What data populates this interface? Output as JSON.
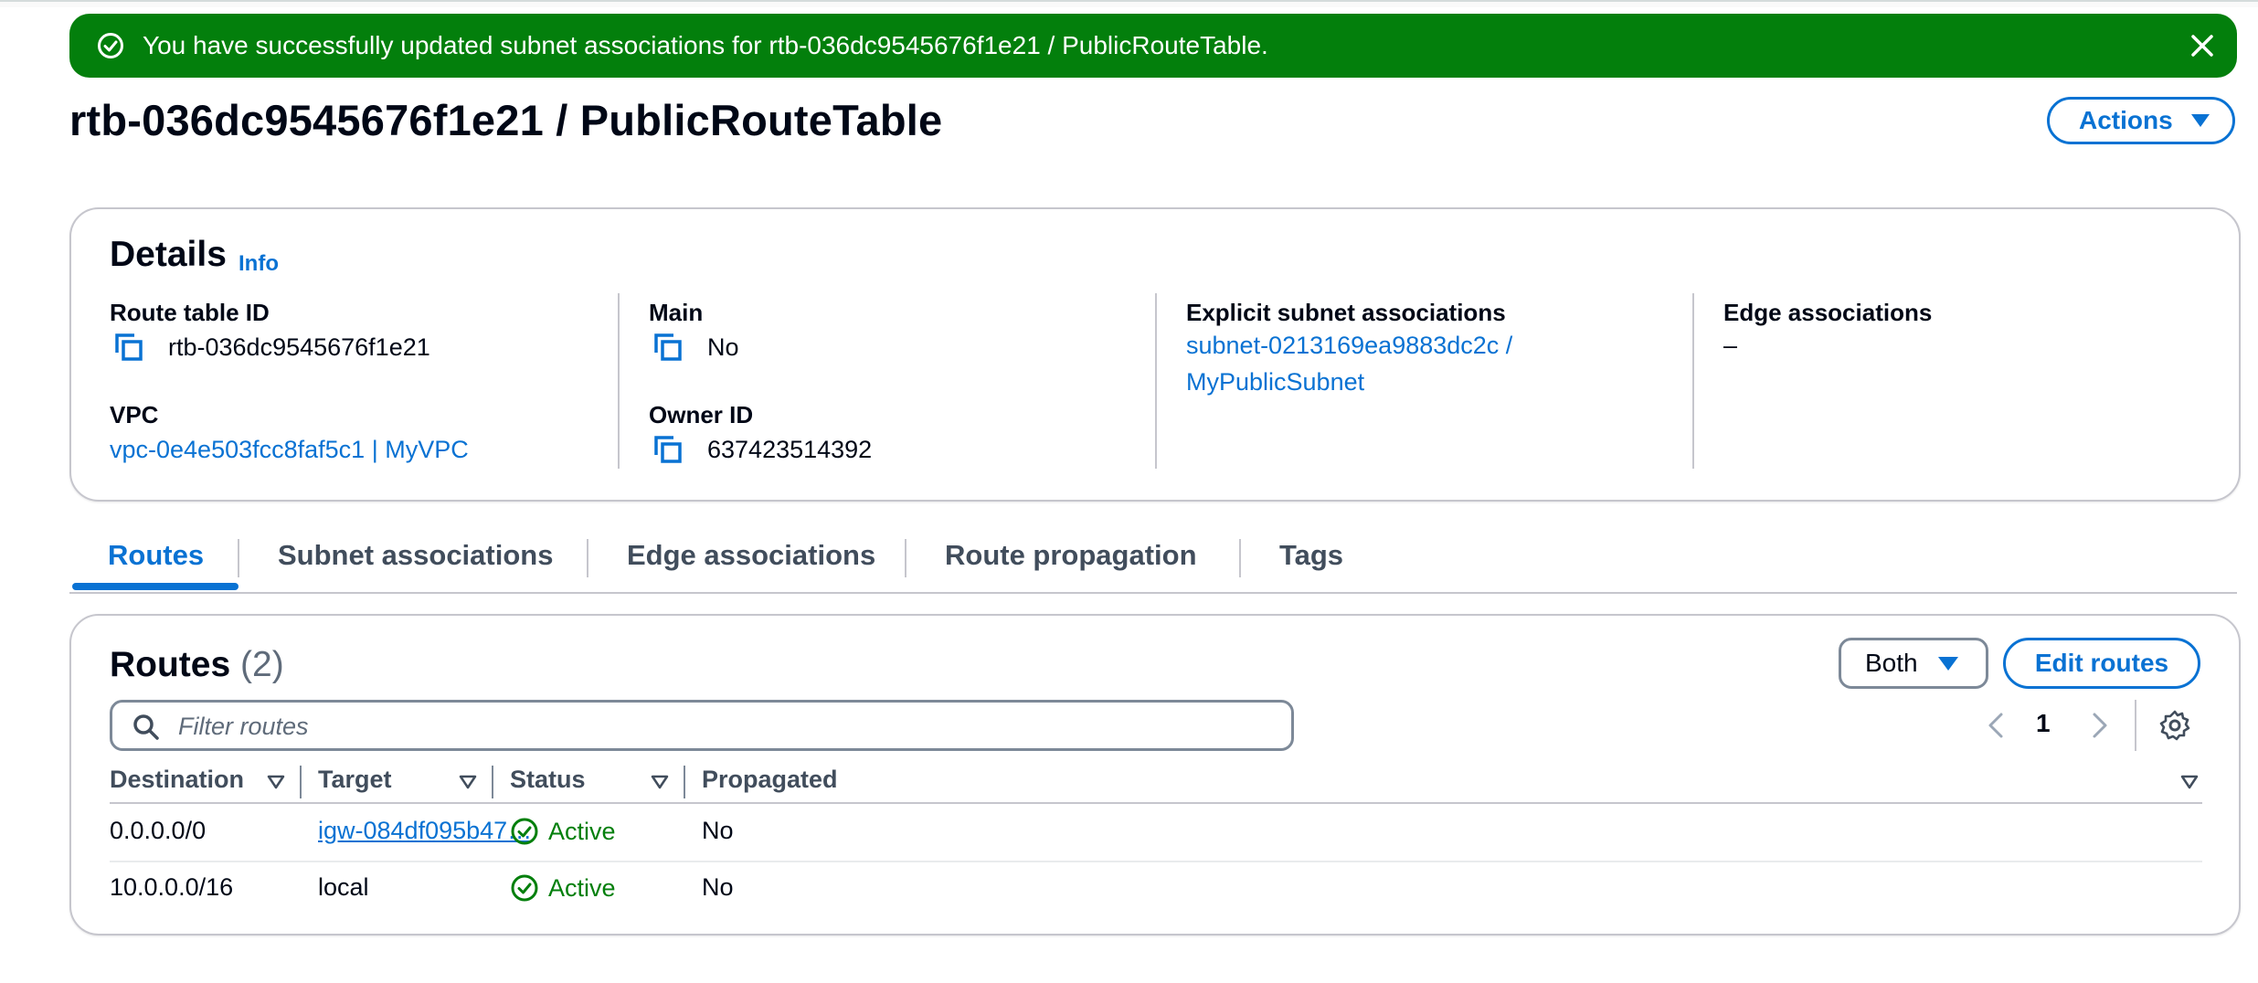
{
  "flash": {
    "message": "You have successfully updated subnet associations for rtb-036dc9545676f1e21 / PublicRouteTable.",
    "icon": "check-circle-icon",
    "close_icon": "close-icon",
    "color": "#037f0c"
  },
  "header": {
    "title": "rtb-036dc9545676f1e21 / PublicRouteTable",
    "actions_label": "Actions"
  },
  "details": {
    "title": "Details",
    "info_label": "Info",
    "route_table_id_label": "Route table ID",
    "route_table_id_value": "rtb-036dc9545676f1e21",
    "vpc_label": "VPC",
    "vpc_value": "vpc-0e4e503fcc8faf5c1 | MyVPC",
    "main_label": "Main",
    "main_value": "No",
    "owner_id_label": "Owner ID",
    "owner_id_value": "637423514392",
    "explicit_label": "Explicit subnet associations",
    "explicit_value_line1": "subnet-0213169ea9883dc2c /",
    "explicit_value_line2": "MyPublicSubnet",
    "edge_label": "Edge associations",
    "edge_value": "–"
  },
  "tabs": [
    {
      "label": "Routes",
      "active": true
    },
    {
      "label": "Subnet associations",
      "active": false
    },
    {
      "label": "Edge associations",
      "active": false
    },
    {
      "label": "Route propagation",
      "active": false
    },
    {
      "label": "Tags",
      "active": false
    }
  ],
  "routes": {
    "title": "Routes",
    "count": "(2)",
    "filter_select": "Both",
    "edit_label": "Edit routes",
    "filter_placeholder": "Filter routes",
    "page": "1",
    "columns": [
      "Destination",
      "Target",
      "Status",
      "Propagated"
    ],
    "rows": [
      {
        "destination": "0.0.0.0/0",
        "target": "igw-084df095b47…",
        "status": "Active",
        "propagated": "No"
      },
      {
        "destination": "10.0.0.0/16",
        "target": "local",
        "status": "Active",
        "propagated": "No"
      }
    ]
  },
  "colors": {
    "accent": "#0972d3",
    "success": "#037f0c",
    "border": "#c6c6cd"
  }
}
